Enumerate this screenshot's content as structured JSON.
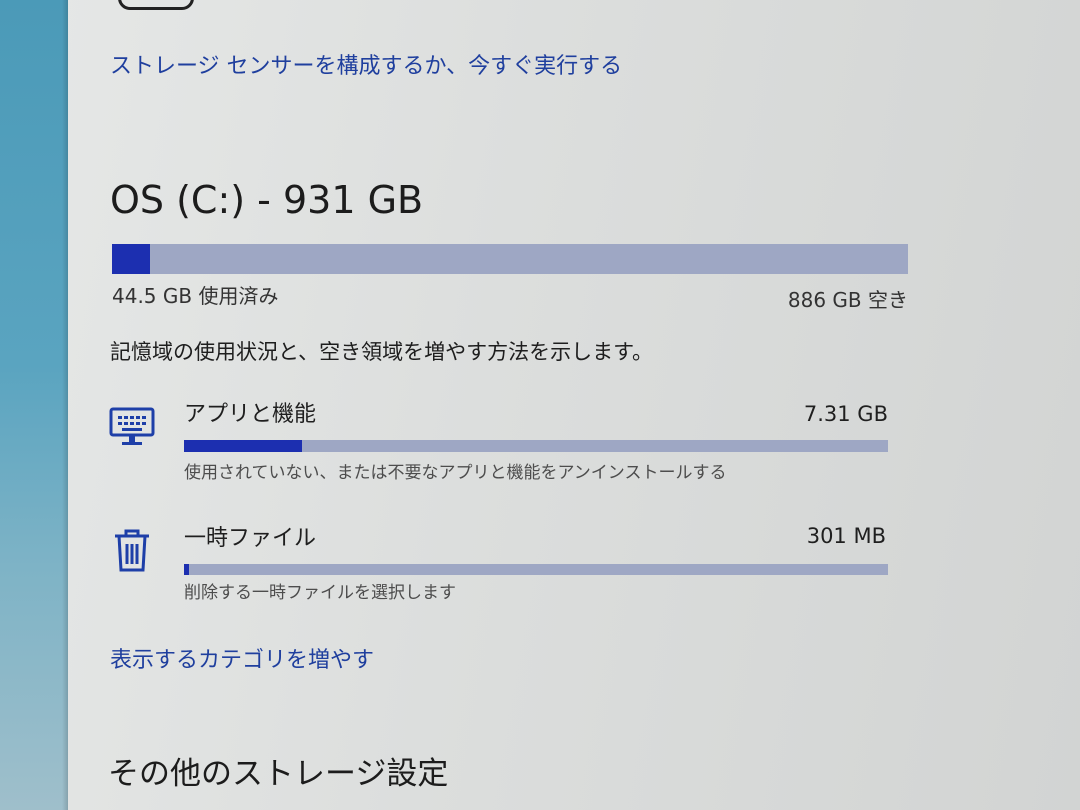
{
  "storage_sense_link": "ストレージ センサーを構成するか、今すぐ実行する",
  "drive": {
    "title": "OS (C:) - 931 GB",
    "used_label": "44.5 GB 使用済み",
    "free_label": "886 GB 空き",
    "used_fraction": 0.048
  },
  "description": "記憶域の使用状況と、空き領域を増やす方法を示します。",
  "categories": [
    {
      "icon": "monitor-keyboard-icon",
      "title": "アプリと機能",
      "size": "7.31 GB",
      "subtitle": "使用されていない、または不要なアプリと機能をアンインストールする",
      "fraction": 0.167
    },
    {
      "icon": "trash-icon",
      "title": "一時ファイル",
      "size": "301 MB",
      "subtitle": "削除する一時ファイルを選択します",
      "fraction": 0.007
    }
  ],
  "more_categories_link": "表示するカテゴリを増やす",
  "other_settings_heading": "その他のストレージ設定",
  "colors": {
    "accent": "#1c2fb0",
    "link": "#1f3f9e",
    "track": "#9ea7c4"
  }
}
